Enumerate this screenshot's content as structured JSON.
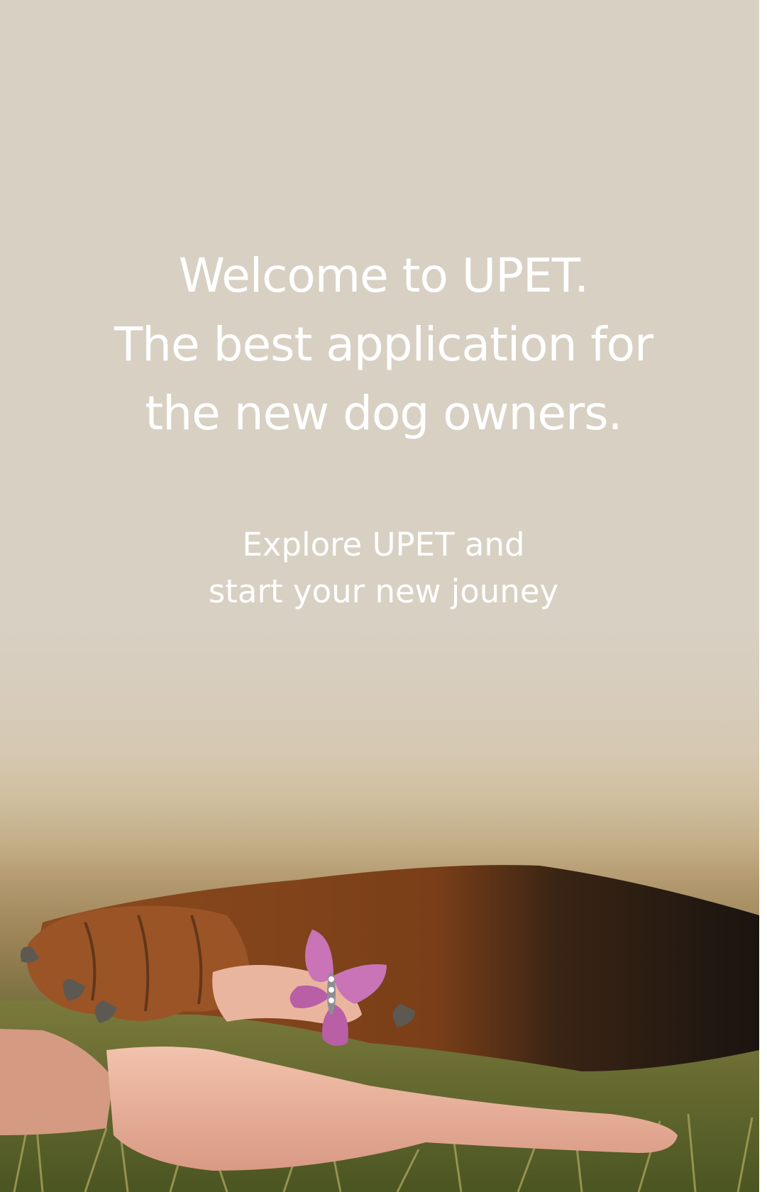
{
  "welcome": {
    "headline_lines": [
      "Welcome to UPET.",
      "The best application for",
      "the new dog owners."
    ],
    "subtitle_lines": [
      "Explore UPET and",
      "start your new jouney"
    ]
  },
  "background": {
    "image": "dog-paw-in-human-hand-photo",
    "top_color": "#d8d0c3",
    "grass_color": "#5f6530"
  }
}
